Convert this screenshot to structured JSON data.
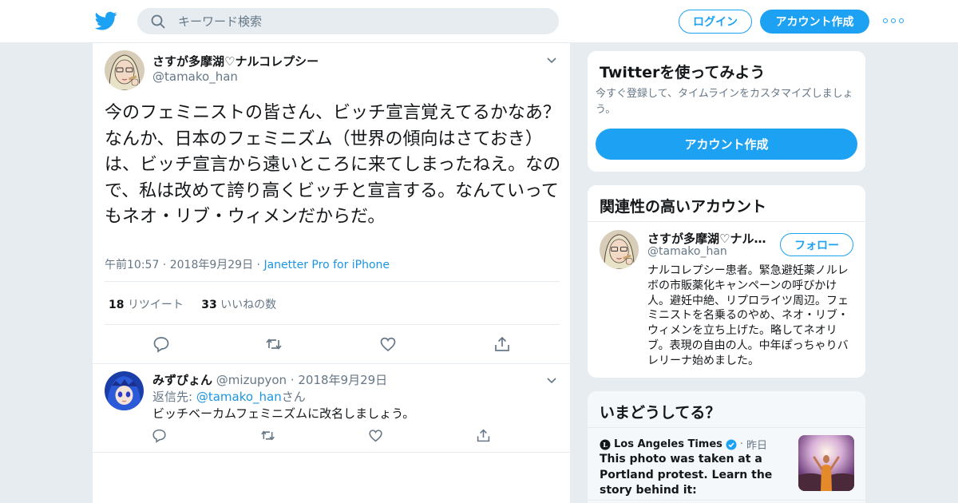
{
  "header": {
    "logo_icon": "twitter-bird-icon",
    "search_placeholder": "キーワード検索",
    "login_label": "ログイン",
    "signup_label": "アカウント作成",
    "more_icon": "more-dots-icon",
    "brand_color": "#1da1f2"
  },
  "tweet": {
    "author_name": "さすが多摩湖♡ナルコレプシー",
    "author_handle": "@tamako_han",
    "text": "今のフェミニストの皆さん、ビッチ宣言覚えてるかなあ？なんか、日本のフェミニズム（世界の傾向はさておき）は、ビッチ宣言から遠いところに来てしまったねえ。なので、私は改めて誇り高くビッチと宣言する。なんていってもネオ・リブ・ウィメンだからだ。",
    "time": "午前10:57",
    "date": "2018年9月29日",
    "source": "Janetter Pro for iPhone",
    "retweet_count": "18",
    "retweet_label": "リツイート",
    "like_count": "33",
    "like_label": "いいねの数"
  },
  "reply": {
    "author_name": "みずぴょん",
    "author_handle": "@mizupyon",
    "date": "2018年9月29日",
    "reply_prefix": "返信先:",
    "reply_to": "@tamako_han",
    "reply_suffix": "さん",
    "text": "ビッチベーカムフェミニズムに改名しましょう。"
  },
  "sidebar": {
    "signup_card": {
      "title": "Twitterを使ってみよう",
      "desc": "今すぐ登録して、タイムラインをカスタマイズしましょう。",
      "button": "アカウント作成"
    },
    "related_card": {
      "title": "関連性の高いアカウント",
      "name": "さすが多摩湖♡ナル…",
      "handle": "@tamako_han",
      "follow_label": "フォロー",
      "bio": "ナルコレプシー患者。緊急避妊薬ノルレボの市販薬化キャンペーンの呼びかけ人。避妊中絶、リプロライツ周辺。フェミニストを名乗るのやめ、ネオ・リブ・ウィメンを立ち上げた。略してネオリブ。表現の自由の人。中年ぽっちゃりバレリーナ始めました。"
    },
    "trends_card": {
      "title": "いまどうしてる？",
      "source": "Los Angeles Times",
      "time": "昨日",
      "headline": "This photo was taken at a Portland protest. Learn the story behind it:"
    }
  }
}
